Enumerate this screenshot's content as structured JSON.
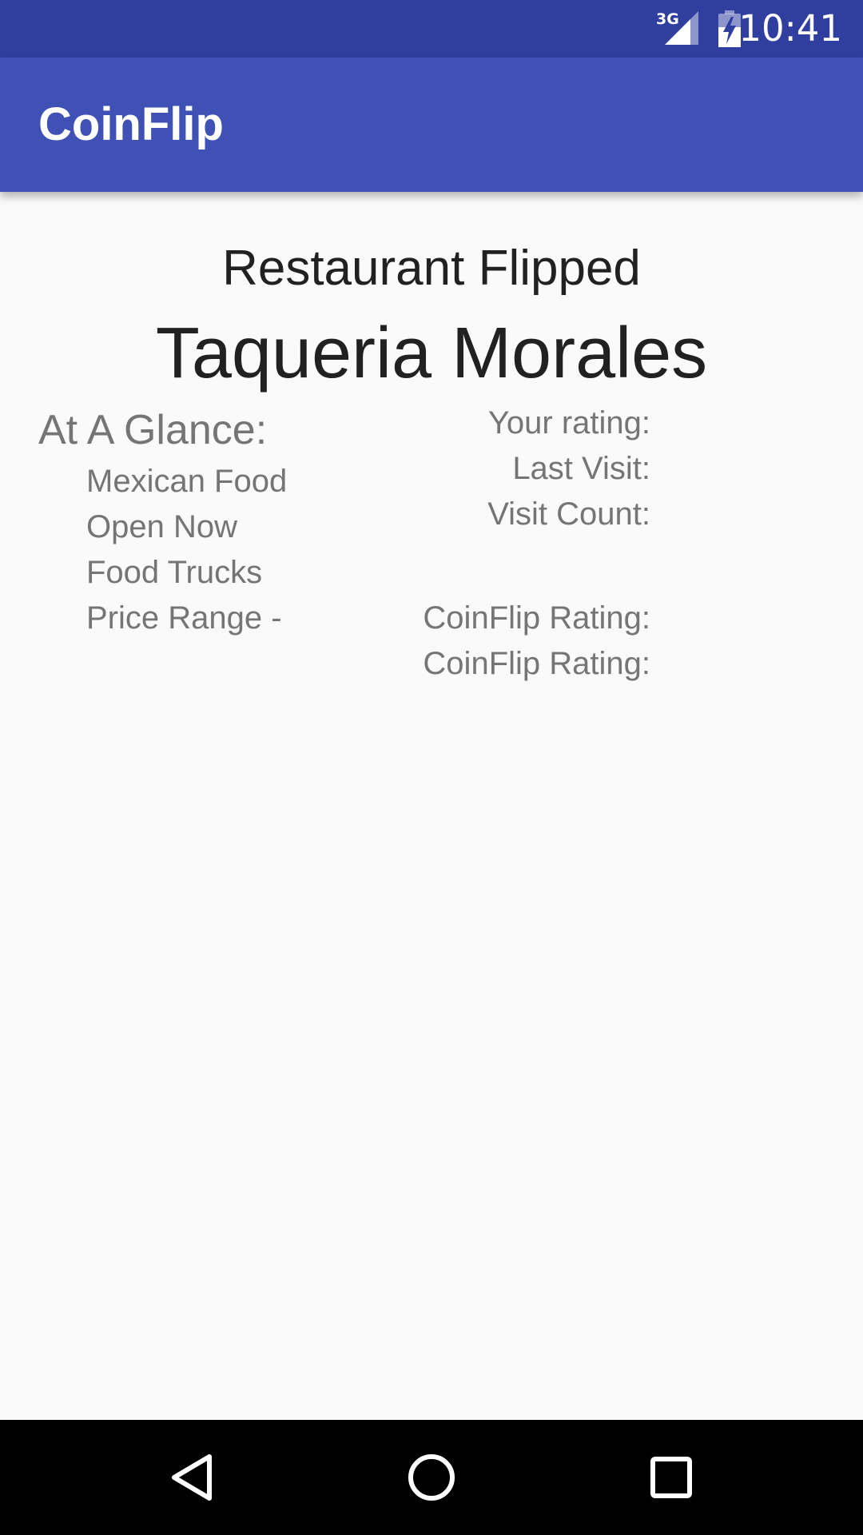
{
  "status_bar": {
    "network_label": "3G",
    "time": "10:41",
    "icons": [
      "signal-icon",
      "battery-charging-icon"
    ]
  },
  "app_bar": {
    "title": "CoinFlip"
  },
  "result": {
    "heading": "Restaurant Flipped",
    "restaurant_name": "Taqueria Morales"
  },
  "at_a_glance": {
    "title": "At A Glance:",
    "items": [
      "Mexican Food",
      "Open Now",
      "Food Trucks",
      "Price Range -"
    ]
  },
  "stats": {
    "your_rating_label": "Your rating:",
    "last_visit_label": "Last Visit:",
    "visit_count_label": "Visit Count:",
    "coinflip_rating_labels": [
      "CoinFlip Rating:",
      "CoinFlip Rating:"
    ]
  },
  "navigation": {
    "icons": [
      "back-icon",
      "home-icon",
      "recents-icon"
    ]
  },
  "colors": {
    "status_bar": "#303f9f",
    "app_bar": "#3f51b5",
    "background": "#fafafa",
    "primary_text": "#212121",
    "secondary_text": "#757575",
    "nav_bar": "#000000"
  }
}
